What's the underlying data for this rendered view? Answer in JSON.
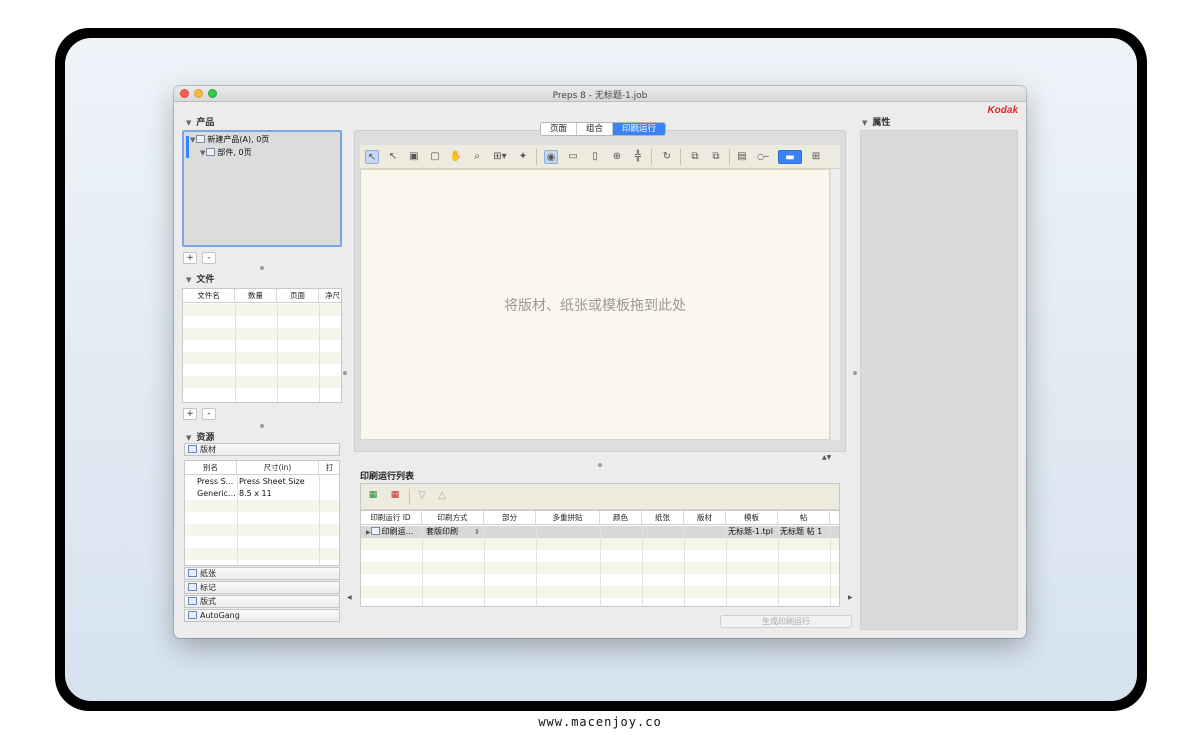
{
  "window": {
    "title": "Preps 8 - 无标题-1.job",
    "brand": "Kodak"
  },
  "products": {
    "section": "产品",
    "tree": [
      {
        "label": "新建产品(A), 0页"
      },
      {
        "label": "部件, 0页"
      }
    ],
    "add": "+",
    "remove": "-"
  },
  "files": {
    "section": "文件",
    "columns": [
      "文件名",
      "数量",
      "页面",
      "净尺"
    ],
    "add": "+",
    "remove": "-"
  },
  "resources": {
    "section": "资源",
    "active_tab": "版材",
    "columns": [
      "别名",
      "尺寸(in)",
      "打"
    ],
    "rows": [
      {
        "alias": "Press S...",
        "size": "Press Sheet Size"
      },
      {
        "alias": "Generic...",
        "size": "8.5 x 11"
      }
    ],
    "other_tabs": [
      "纸张",
      "标记",
      "版式",
      "AutoGang"
    ]
  },
  "center": {
    "tabs": [
      "页面",
      "组合",
      "印刷运行"
    ],
    "active_tab": "印刷运行",
    "drop_hint": "将版材、纸张或模板拖到此处"
  },
  "toolbar_icons": [
    "arrow-select-icon",
    "arrow-icon",
    "page-add-icon",
    "page-icon",
    "hand-icon",
    "zoom-icon",
    "grid-icon",
    "magic-icon",
    "eye-icon",
    "ruler-icon",
    "doc-icon",
    "crosshair-icon",
    "split-icon",
    "rotate-icon",
    "copy-icon",
    "paste-icon",
    "image-icon",
    "view-single-icon",
    "view-multi-icon"
  ],
  "runlist": {
    "title": "印刷运行列表",
    "columns": [
      "印刷运行 ID",
      "印刷方式",
      "部分",
      "多重拼贴",
      "颜色",
      "纸张",
      "版材",
      "模板",
      "帖"
    ],
    "rows": [
      {
        "id": "印刷运...",
        "method": "套版印刷",
        "part": "",
        "multi": "",
        "color": "",
        "paper": "",
        "plate": "",
        "template": "无标题-1.tpl",
        "signature": "无标题 帖 1"
      }
    ],
    "generate_button": "生成印刷运行"
  },
  "properties": {
    "section": "属性"
  },
  "footer": {
    "url": "www.macenjoy.co"
  }
}
